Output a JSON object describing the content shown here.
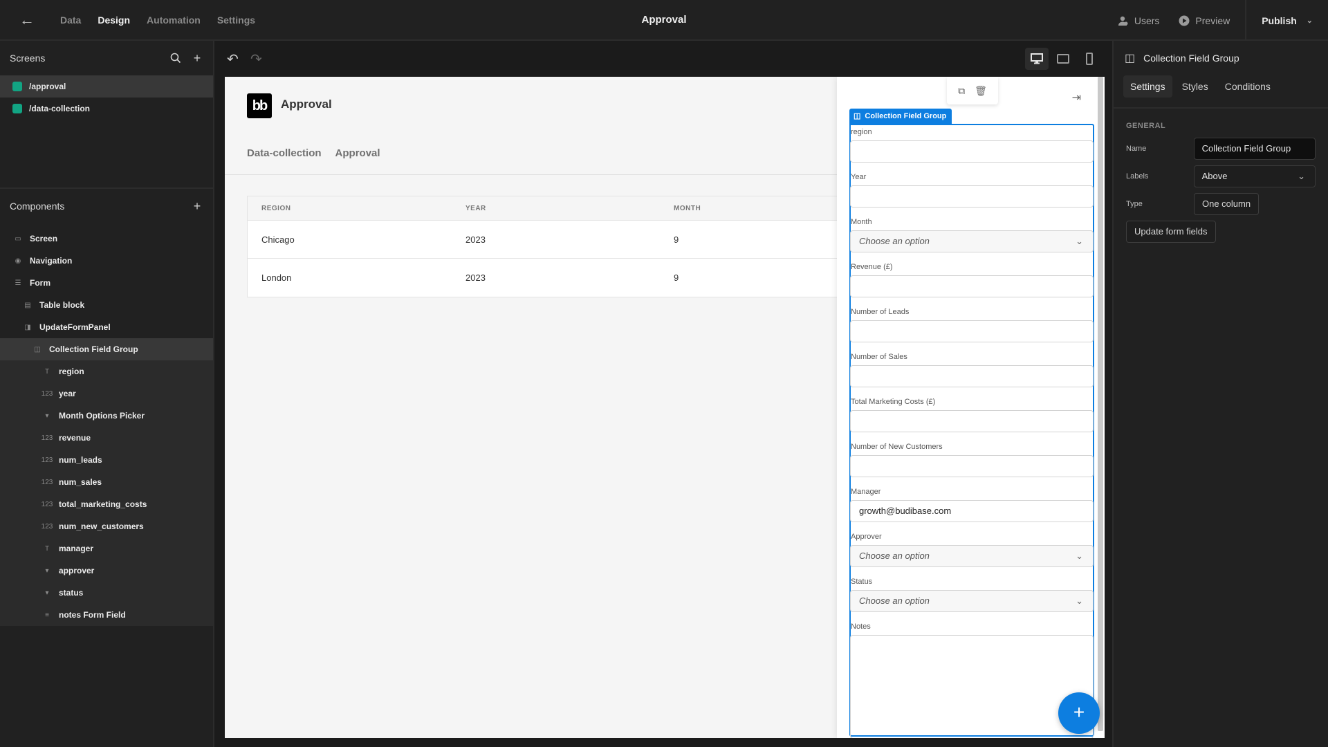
{
  "topbar": {
    "nav_tabs": [
      {
        "label": "Data",
        "active": false
      },
      {
        "label": "Design",
        "active": true
      },
      {
        "label": "Automation",
        "active": false
      },
      {
        "label": "Settings",
        "active": false
      }
    ],
    "app_title": "Approval",
    "users_label": "Users",
    "preview_label": "Preview",
    "publish_label": "Publish"
  },
  "screens": {
    "title": "Screens",
    "items": [
      {
        "label": "/approval",
        "active": true,
        "color": "#12a483"
      },
      {
        "label": "/data-collection",
        "active": false,
        "color": "#12a483"
      }
    ]
  },
  "components": {
    "title": "Components",
    "items": [
      {
        "label": "Screen",
        "icon": "screen-icon",
        "glyph": "▭",
        "level": 0
      },
      {
        "label": "Navigation",
        "icon": "eye-icon",
        "glyph": "◉",
        "level": 0
      },
      {
        "label": "Form",
        "icon": "form-icon",
        "glyph": "☰",
        "level": 0
      },
      {
        "label": "Table block",
        "icon": "table-icon",
        "glyph": "▤",
        "level": 1
      },
      {
        "label": "UpdateFormPanel",
        "icon": "side-panel-icon",
        "glyph": "◨",
        "level": 1
      },
      {
        "label": "Collection Field Group",
        "icon": "field-group-icon",
        "glyph": "◫",
        "level": 2,
        "selected": true
      },
      {
        "label": "region",
        "icon": "text-icon",
        "glyph": "T",
        "level": 3
      },
      {
        "label": "year",
        "icon": "number-icon",
        "glyph": "123",
        "level": 3
      },
      {
        "label": "Month Options Picker",
        "icon": "dropdown-icon",
        "glyph": "▾",
        "level": 3
      },
      {
        "label": "revenue",
        "icon": "number-icon",
        "glyph": "123",
        "level": 3
      },
      {
        "label": "num_leads",
        "icon": "number-icon",
        "glyph": "123",
        "level": 3
      },
      {
        "label": "num_sales",
        "icon": "number-icon",
        "glyph": "123",
        "level": 3
      },
      {
        "label": "total_marketing_costs",
        "icon": "number-icon",
        "glyph": "123",
        "level": 3
      },
      {
        "label": "num_new_customers",
        "icon": "number-icon",
        "glyph": "123",
        "level": 3
      },
      {
        "label": "manager",
        "icon": "text-icon",
        "glyph": "T",
        "level": 3
      },
      {
        "label": "approver",
        "icon": "dropdown-icon",
        "glyph": "▾",
        "level": 3
      },
      {
        "label": "status",
        "icon": "dropdown-icon",
        "glyph": "▾",
        "level": 3
      },
      {
        "label": "notes Form Field",
        "icon": "long-text-icon",
        "glyph": "≡",
        "level": 3
      }
    ]
  },
  "preview": {
    "logo_text": "bb",
    "title": "Approval",
    "nav": [
      "Data-collection",
      "Approval"
    ],
    "table": {
      "columns": [
        "REGION",
        "YEAR",
        "MONTH"
      ],
      "rows": [
        [
          "Chicago",
          "2023",
          "9"
        ],
        [
          "London",
          "2023",
          "9"
        ]
      ]
    },
    "drawer": {
      "tag_label": "Collection Field Group",
      "fields": [
        {
          "label": "region",
          "type": "text",
          "value": ""
        },
        {
          "label": "Year",
          "type": "text",
          "value": ""
        },
        {
          "label": "Month",
          "type": "select",
          "placeholder": "Choose an option"
        },
        {
          "label": "Revenue (£)",
          "type": "text",
          "value": ""
        },
        {
          "label": "Number of Leads",
          "type": "text",
          "value": ""
        },
        {
          "label": "Number of Sales",
          "type": "text",
          "value": ""
        },
        {
          "label": "Total Marketing Costs (£)",
          "type": "text",
          "value": ""
        },
        {
          "label": "Number of New Customers",
          "type": "text",
          "value": ""
        },
        {
          "label": "Manager",
          "type": "text",
          "value": "growth@budibase.com"
        },
        {
          "label": "Approver",
          "type": "select",
          "placeholder": "Choose an option"
        },
        {
          "label": "Status",
          "type": "select",
          "placeholder": "Choose an option"
        },
        {
          "label": "Notes",
          "type": "textarea",
          "value": ""
        }
      ],
      "fab_label": "+"
    }
  },
  "settings_panel": {
    "component_title": "Collection Field Group",
    "tabs": [
      {
        "label": "Settings",
        "active": true
      },
      {
        "label": "Styles",
        "active": false
      },
      {
        "label": "Conditions",
        "active": false
      }
    ],
    "section_title": "GENERAL",
    "name_label": "Name",
    "name_value": "Collection Field Group",
    "labels_label": "Labels",
    "labels_value": "Above",
    "type_label": "Type",
    "type_value": "One column",
    "update_button": "Update form fields"
  },
  "colors": {
    "accent": "#0d7ee0",
    "screen_dot": "#12a483"
  }
}
